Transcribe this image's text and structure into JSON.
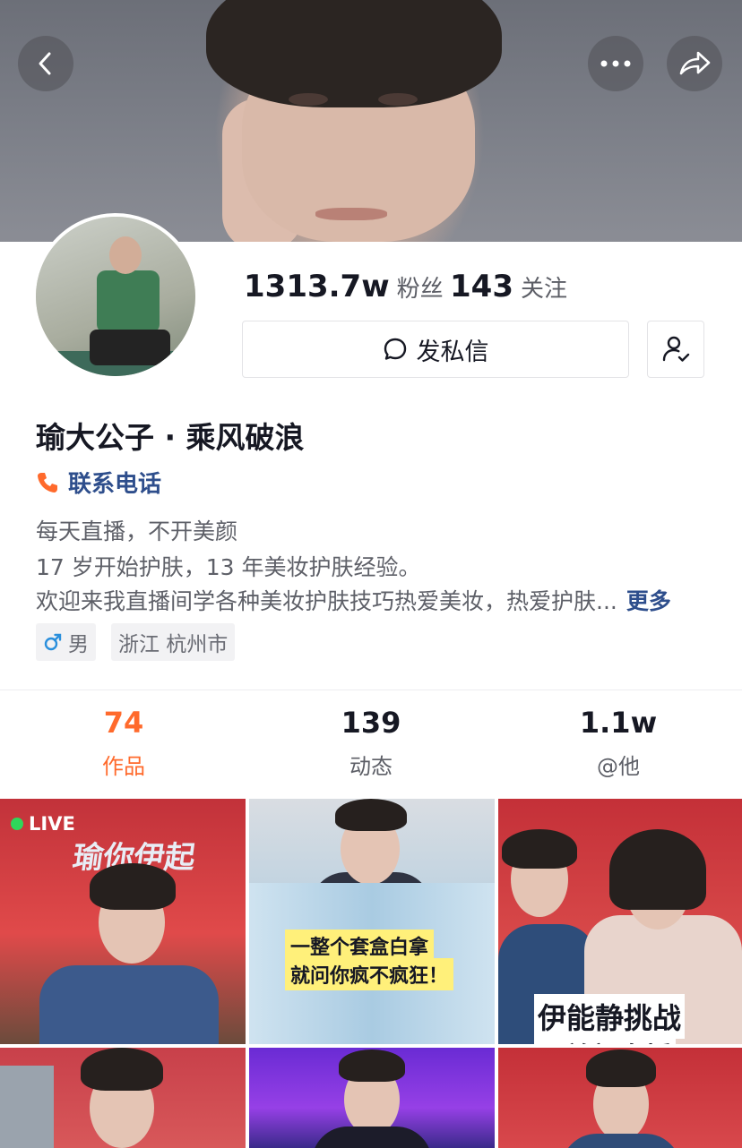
{
  "header": {
    "back_icon": "chevron-left-icon",
    "more_icon": "more-dots-icon",
    "share_icon": "share-arrow-icon"
  },
  "profile": {
    "followers_count": "1313.7w",
    "followers_label": "粉丝",
    "following_count": "143",
    "following_label": "关注",
    "message_button": "发私信",
    "name": "瑜大公子 · 乘风破浪",
    "phone_label": "联系电话",
    "bio_line_1": "每天直播，不开美颜",
    "bio_line_2": "17 岁开始护肤，13 年美妆护肤经验。",
    "bio_line_3": "欢迎来我直播间学各种美妆护肤技巧热爱美妆，热爱护肤...",
    "more_label": "更多",
    "gender": "男",
    "location": "浙江 杭州市",
    "accent_color": "#ff6a2c",
    "link_color": "#2e4e8c"
  },
  "tabs": [
    {
      "count": "74",
      "label": "作品",
      "active": true
    },
    {
      "count": "139",
      "label": "动态",
      "active": false
    },
    {
      "count": "1.1w",
      "label": "@他",
      "active": false
    }
  ],
  "grid": {
    "live_badge": "LIVE",
    "stage_text_1": "瑜你伊起",
    "caption_2_line_1": "一整个套盒白拿",
    "caption_2_line_2": "就问你疯不疯狂！",
    "caption_3": "伊能静挑战",
    "caption_3_partial": "无美颜直播"
  }
}
